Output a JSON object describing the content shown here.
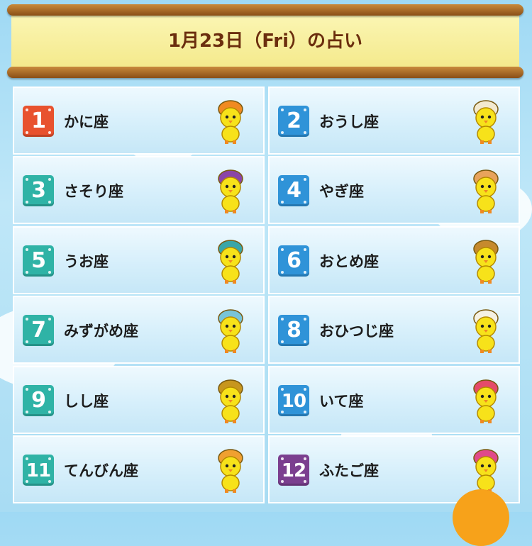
{
  "header": {
    "title": "1月23日（Fri）の占い"
  },
  "colors": {
    "badge_red": "#e8522e",
    "badge_blue": "#2f93d8",
    "badge_teal": "#2fb3a6",
    "badge_purple": "#7b3f8f",
    "banner_text": "#6b2e0e",
    "chick_yellow": "#f7e21a"
  },
  "signs": [
    {
      "rank": "1",
      "name": "かに座",
      "badge_color": "#e8522e",
      "icon": "crab-chick-icon",
      "accent": "#f08a22"
    },
    {
      "rank": "2",
      "name": "おうし座",
      "badge_color": "#2f93d8",
      "icon": "bull-chick-icon",
      "accent": "#f3ead0"
    },
    {
      "rank": "3",
      "name": "さそり座",
      "badge_color": "#2fb3a6",
      "icon": "scorpion-chick-icon",
      "accent": "#8a45a8"
    },
    {
      "rank": "4",
      "name": "やぎ座",
      "badge_color": "#2f93d8",
      "icon": "goat-chick-icon",
      "accent": "#e8a35c"
    },
    {
      "rank": "5",
      "name": "うお座",
      "badge_color": "#2fb3a6",
      "icon": "fish-chick-icon",
      "accent": "#3aa6a8"
    },
    {
      "rank": "6",
      "name": "おとめ座",
      "badge_color": "#2f93d8",
      "icon": "virgo-chick-icon",
      "accent": "#c68a2e"
    },
    {
      "rank": "7",
      "name": "みずがめ座",
      "badge_color": "#2fb3a6",
      "icon": "aquarius-jar-icon",
      "accent": "#78c4d8"
    },
    {
      "rank": "8",
      "name": "おひつじ座",
      "badge_color": "#2f93d8",
      "icon": "ram-chick-icon",
      "accent": "#f5f1e3"
    },
    {
      "rank": "9",
      "name": "しし座",
      "badge_color": "#2fb3a6",
      "icon": "lion-chick-icon",
      "accent": "#c7961e"
    },
    {
      "rank": "10",
      "name": "いて座",
      "badge_color": "#2f93d8",
      "icon": "archer-chick-icon",
      "accent": "#e54a6a"
    },
    {
      "rank": "11",
      "name": "てんびん座",
      "badge_color": "#2fb3a6",
      "icon": "libra-chick-icon",
      "accent": "#f0a030"
    },
    {
      "rank": "12",
      "name": "ふたご座",
      "badge_color": "#7b3f8f",
      "icon": "twins-chick-icon",
      "accent": "#e04a8a"
    }
  ]
}
